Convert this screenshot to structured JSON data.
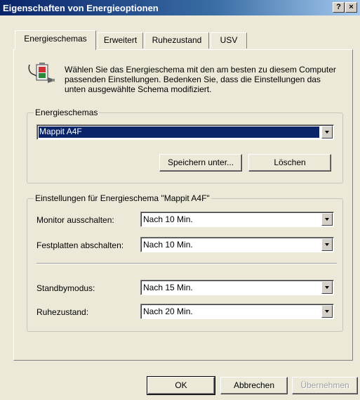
{
  "window": {
    "title": "Eigenschaften von Energieoptionen",
    "help_label": "?",
    "close_label": "×"
  },
  "tabs": [
    {
      "label": "Energieschemas",
      "active": true
    },
    {
      "label": "Erweitert",
      "active": false
    },
    {
      "label": "Ruhezustand",
      "active": false
    },
    {
      "label": "USV",
      "active": false
    }
  ],
  "description": "Wählen Sie das Energieschema mit den am besten zu diesem Computer passenden Einstellungen. Bedenken Sie, dass die Einstellungen das unten ausgewählte Schema modifiziert.",
  "schemes_group": {
    "legend": "Energieschemas",
    "selected": "Mappit A4F",
    "save_as_label": "Speichern unter...",
    "delete_label": "Löschen"
  },
  "settings_group": {
    "legend": "Einstellungen für Energieschema \"Mappit A4F\"",
    "monitor": {
      "label": "Monitor ausschalten:",
      "value": "Nach 10 Min."
    },
    "harddisks": {
      "label": "Festplatten abschalten:",
      "value": "Nach 10 Min."
    },
    "standby": {
      "label": "Standbymodus:",
      "value": "Nach 15 Min."
    },
    "hibernate": {
      "label": "Ruhezustand:",
      "value": "Nach 20 Min."
    }
  },
  "footer": {
    "ok_label": "OK",
    "cancel_label": "Abbrechen",
    "apply_label": "Übernehmen"
  },
  "colors": {
    "titlebar_start": "#0a246a",
    "titlebar_end": "#a6caf0",
    "selection": "#0a246a",
    "dialog_bg": "#ece9d8"
  }
}
